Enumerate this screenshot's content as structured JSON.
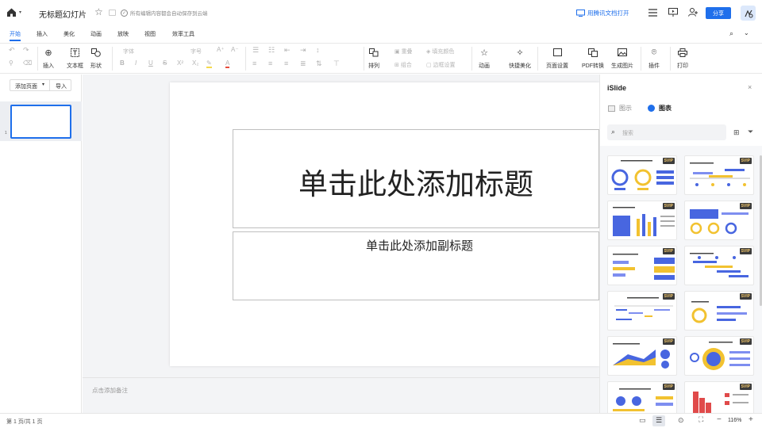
{
  "topbar": {
    "doc_title": "无标题幻灯片",
    "save_status": "所有编辑内容都会自动保存到云端",
    "open_in_app": "用腾讯文档打开",
    "share_label": "分享"
  },
  "menu": {
    "tabs": [
      "开始",
      "插入",
      "美化",
      "动画",
      "放映",
      "视图",
      "效率工具"
    ],
    "active_tab": "开始"
  },
  "toolbar": {
    "insert": "插入",
    "textbox": "文本框",
    "shape": "形状",
    "font": "字体",
    "font_size": "字号",
    "arrange": "排列",
    "sort": "重叠",
    "group": "组合",
    "fill_color": "填充颜色",
    "border_setting": "边框设置",
    "animation": "动画",
    "quick_beautify": "快捷美化",
    "page_setting": "页面设置",
    "pdf_convert": "PDF转换",
    "gen_image": "生成图片",
    "plugin": "插件",
    "print": "打印"
  },
  "left": {
    "add_page": "添加页面",
    "import": "导入",
    "slide_number": "1"
  },
  "slide": {
    "title_placeholder": "单击此处添加标题",
    "subtitle_placeholder": "单击此处添加副标题"
  },
  "notes": {
    "placeholder": "点击添加备注"
  },
  "islide": {
    "title": "iSlide",
    "tab_diagram": "图示",
    "tab_chart": "图表",
    "search_placeholder": "搜索",
    "badge": "SVIP"
  },
  "status": {
    "page_info": "第 1 页/共 1 页",
    "zoom": "116%"
  },
  "colors": {
    "accent": "#1f6feb",
    "share_button": "#1f6feb",
    "vip_badge": "#3b3b3b"
  }
}
